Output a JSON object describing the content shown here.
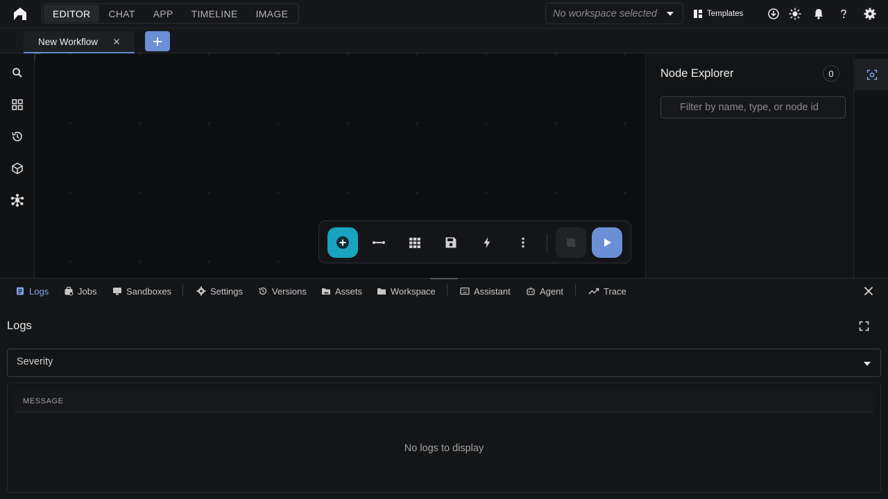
{
  "header": {
    "modes": [
      {
        "label": "EDITOR",
        "active": true
      },
      {
        "label": "CHAT",
        "active": false
      },
      {
        "label": "APP",
        "active": false
      },
      {
        "label": "TIMELINE",
        "active": false
      },
      {
        "label": "IMAGE",
        "active": false
      }
    ],
    "workspace_placeholder": "No workspace selected",
    "templates_label": "Templates",
    "icons": [
      "download-icon",
      "theme-sun-icon",
      "bell-icon",
      "help-icon",
      "gear-icon"
    ]
  },
  "tabs": {
    "workflow_tab": "New Workflow"
  },
  "left_rail": {
    "icons": [
      "search-icon",
      "grid-icon",
      "history-icon",
      "cube-icon",
      "nodes-icon"
    ]
  },
  "toolbar": {
    "buttons": [
      "add-node",
      "connect",
      "layout",
      "save",
      "quick-action",
      "more",
      "stop",
      "run"
    ]
  },
  "node_explorer": {
    "title": "Node Explorer",
    "count": "0",
    "filter_placeholder": "Filter by name, type, or node id"
  },
  "bottom_panel": {
    "tabs": [
      {
        "label": "Logs",
        "active": true
      },
      {
        "label": "Jobs"
      },
      {
        "label": "Sandboxes"
      },
      {
        "label": "Settings"
      },
      {
        "label": "Versions"
      },
      {
        "label": "Assets"
      },
      {
        "label": "Workspace"
      },
      {
        "label": "Assistant"
      },
      {
        "label": "Agent"
      },
      {
        "label": "Trace"
      }
    ],
    "title": "Logs",
    "severity_label": "Severity",
    "column_message": "MESSAGE",
    "empty_text": "No logs to display"
  },
  "colors": {
    "accent_blue": "#6a8fd4",
    "accent_cyan": "#19a3c0",
    "background": "#0f1012"
  }
}
